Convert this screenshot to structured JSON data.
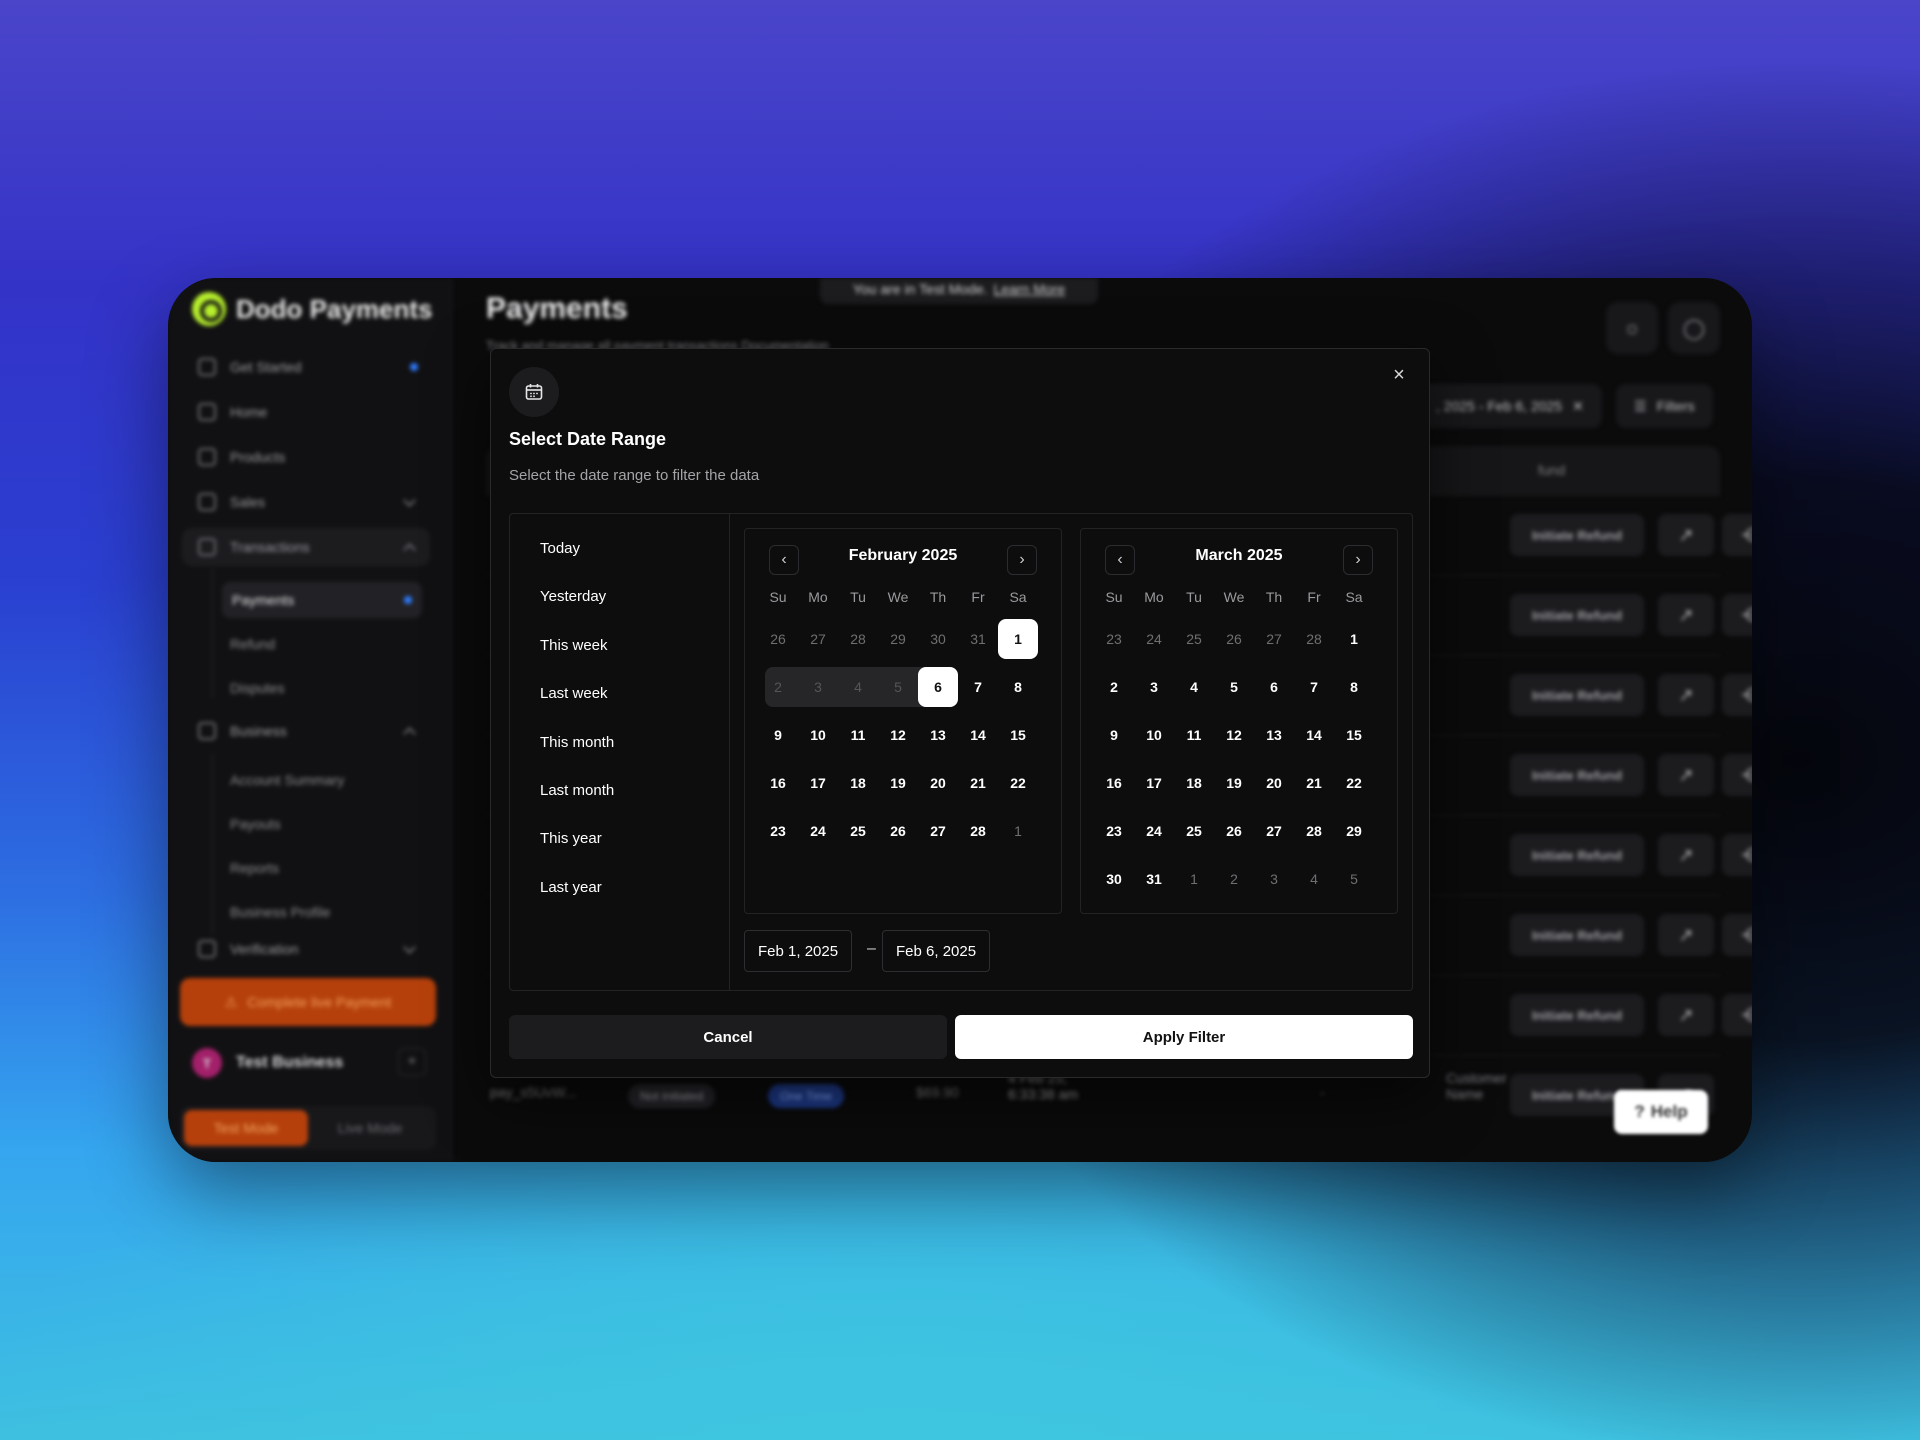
{
  "app": {
    "brand": "Dodo Payments",
    "test_banner": "You are in Test Mode.",
    "test_banner_link": "Learn More",
    "page_title": "Payments",
    "page_subtitle": "Track and manage all payment transactions",
    "page_doc_link": "Documentation",
    "date_chip": ", 2025 - Feb 6, 2025",
    "filters_label": "Filters",
    "refund_col": "fund",
    "refund_label": "Initiate Refund",
    "help_label": "Help",
    "last_row": {
      "id": "pay_s5UvW...",
      "status": "Not initiated",
      "type": "One Time",
      "amount": "$69.90",
      "date_line1": "4 Feb 25,",
      "date_line2": "6:33:38 am",
      "dash": "-",
      "customer_line1": "Customer",
      "customer_line2": "Name"
    }
  },
  "sidebar": {
    "items": [
      {
        "label": "Get Started"
      },
      {
        "label": "Home"
      },
      {
        "label": "Products"
      },
      {
        "label": "Sales"
      },
      {
        "label": "Transactions"
      },
      {
        "label": "Business"
      },
      {
        "label": "Verification"
      }
    ],
    "transactions_sub": [
      "Payments",
      "Refund",
      "Disputes"
    ],
    "business_sub": [
      "Account Summary",
      "Payouts",
      "Reports",
      "Business Profile"
    ],
    "live_payment": "Complete live Payment",
    "business_name": "Test Business",
    "business_initial": "T",
    "add": "+",
    "mode_test": "Test Mode",
    "mode_live": "Live Mode"
  },
  "modal": {
    "title": "Select Date Range",
    "subtitle": "Select the date range to filter the data",
    "close": "×",
    "presets": [
      "Today",
      "Yesterday",
      "This week",
      "Last week",
      "This month",
      "Last month",
      "This year",
      "Last year"
    ],
    "weekdays": [
      "Su",
      "Mo",
      "Tu",
      "We",
      "Th",
      "Fr",
      "Sa"
    ],
    "months": [
      {
        "title": "February 2025",
        "days": [
          [
            "26",
            "27",
            "28",
            "29",
            "30",
            "31",
            "1"
          ],
          [
            "2",
            "3",
            "4",
            "5",
            "6",
            "7",
            "8"
          ],
          [
            "9",
            "10",
            "11",
            "12",
            "13",
            "14",
            "15"
          ],
          [
            "16",
            "17",
            "18",
            "19",
            "20",
            "21",
            "22"
          ],
          [
            "23",
            "24",
            "25",
            "26",
            "27",
            "28",
            "1"
          ]
        ]
      },
      {
        "title": "March 2025",
        "days": [
          [
            "23",
            "24",
            "25",
            "26",
            "27",
            "28",
            "1"
          ],
          [
            "2",
            "3",
            "4",
            "5",
            "6",
            "7",
            "8"
          ],
          [
            "9",
            "10",
            "11",
            "12",
            "13",
            "14",
            "15"
          ],
          [
            "16",
            "17",
            "18",
            "19",
            "20",
            "21",
            "22"
          ],
          [
            "23",
            "24",
            "25",
            "26",
            "27",
            "28",
            "29"
          ],
          [
            "30",
            "31",
            "1",
            "2",
            "3",
            "4",
            "5"
          ]
        ]
      }
    ],
    "start_date": "Feb 1, 2025",
    "separator": "–",
    "end_date": "Feb 6, 2025",
    "cancel": "Cancel",
    "apply": "Apply Filter"
  }
}
